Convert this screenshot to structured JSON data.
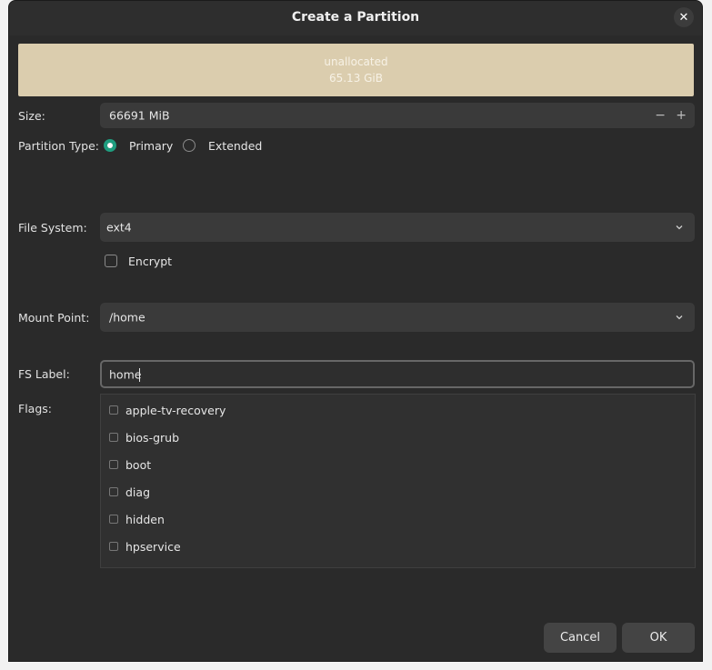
{
  "dialog": {
    "title": "Create a Partition"
  },
  "partition": {
    "name": "unallocated",
    "size": "65.13 GiB"
  },
  "size": {
    "label": "Size:",
    "value": "66691 MiB",
    "decrement": "−",
    "increment": "+"
  },
  "partition_type": {
    "label": "Partition Type:",
    "options": [
      {
        "label": "Primary",
        "selected": true
      },
      {
        "label": "Extended",
        "selected": false
      }
    ]
  },
  "file_system": {
    "label": "File System:",
    "value": "ext4",
    "encrypt_label": "Encrypt"
  },
  "mount_point": {
    "label": "Mount Point:",
    "value": "/home"
  },
  "fs_label": {
    "label": "FS Label:",
    "value": "home"
  },
  "flags": {
    "label": "Flags:",
    "items": [
      "apple-tv-recovery",
      "bios-grub",
      "boot",
      "diag",
      "hidden",
      "hpservice"
    ]
  },
  "buttons": {
    "cancel": "Cancel",
    "ok": "OK"
  },
  "icons": {
    "close": "close-icon",
    "dropdown": "chevron-down-icon"
  },
  "colors": {
    "partition_bar": "#dbcdae",
    "radio_accent": "#1f9d7f",
    "background": "#2a2a2a"
  }
}
